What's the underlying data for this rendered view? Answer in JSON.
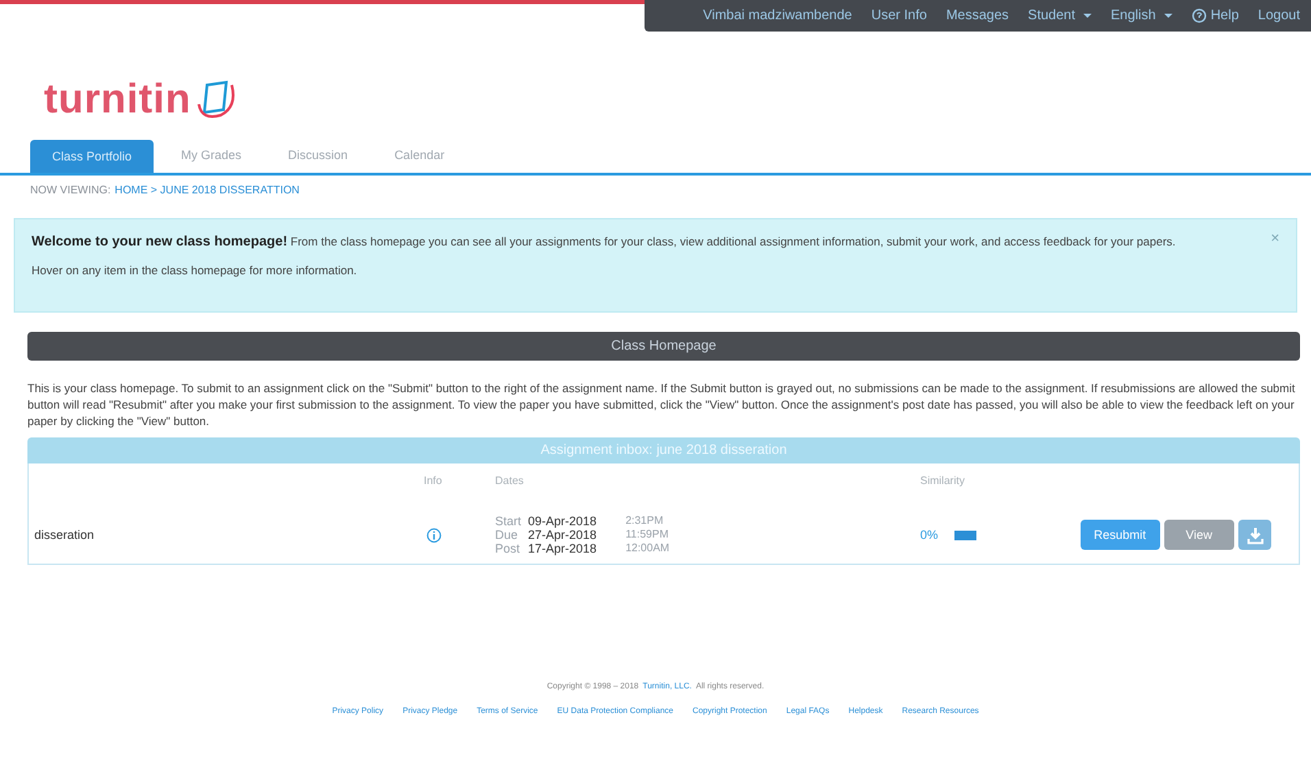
{
  "top_nav": [
    {
      "label": "Vimbai madziwambende",
      "kind": "link"
    },
    {
      "label": "User Info",
      "kind": "link"
    },
    {
      "label": "Messages",
      "kind": "link"
    },
    {
      "label": "Student",
      "kind": "dropdown"
    },
    {
      "label": "English",
      "kind": "dropdown"
    },
    {
      "label": "Help",
      "kind": "help"
    },
    {
      "label": "Logout",
      "kind": "link"
    }
  ],
  "logo": {
    "text": "turnitin"
  },
  "tabs": [
    {
      "label": "Class Portfolio",
      "selected": true
    },
    {
      "label": "My Grades",
      "selected": false
    },
    {
      "label": "Discussion",
      "selected": false
    },
    {
      "label": "Calendar",
      "selected": false
    }
  ],
  "breadcrumb": {
    "prefix": "NOW VIEWING:",
    "path": "HOME > JUNE 2018 DISSERATTION"
  },
  "welcome": {
    "lines": [
      "**Welcome to your new class homepage!** From the class homepage you can see all your assignments for your class, view additional assignment information, submit your work, and access feedback for your papers.",
      "Hover on any item in the class homepage for more information."
    ],
    "close": "×"
  },
  "section_title": "Class Homepage",
  "intro": "This is your class homepage. To submit to an assignment click on the \"Submit\" button to the right of the assignment name. If the Submit button is grayed out, no submissions can be made to the assignment. If resubmissions are allowed the submit button will read \"Resubmit\" after you make your first submission to the assignment. To view the paper you have submitted, click the \"View\" button. Once the assignment's post date has passed, you will also be able to view the feedback left on your paper by clicking the \"View\" button.",
  "inbox": {
    "title": "Assignment inbox: june 2018 disseration",
    "columns": [
      "Info",
      "Dates",
      "Similarity"
    ],
    "rows": [
      {
        "name": "disseration",
        "dates": [
          {
            "label": "Start",
            "date": "09-Apr-2018",
            "time": "2:31PM"
          },
          {
            "label": "Due",
            "date": "27-Apr-2018",
            "time": "11:59PM"
          },
          {
            "label": "Post",
            "date": "17-Apr-2018",
            "time": "12:00AM"
          }
        ],
        "similarity": "0%",
        "buttons": [
          {
            "label": "Resubmit",
            "kind": "primary"
          },
          {
            "label": "View",
            "kind": "secondary"
          },
          {
            "kind": "download"
          }
        ]
      }
    ]
  },
  "footer": {
    "copyright": {
      "before": "Copyright © 1998 – 2018",
      "link": "Turnitin, LLC.",
      "after": "All rights reserved."
    },
    "links": [
      "Privacy Policy",
      "Privacy Pledge",
      "Terms of Service",
      "EU Data Protection Compliance",
      "Copyright Protection",
      "Legal FAQs",
      "Helpdesk",
      "Research Resources"
    ]
  }
}
